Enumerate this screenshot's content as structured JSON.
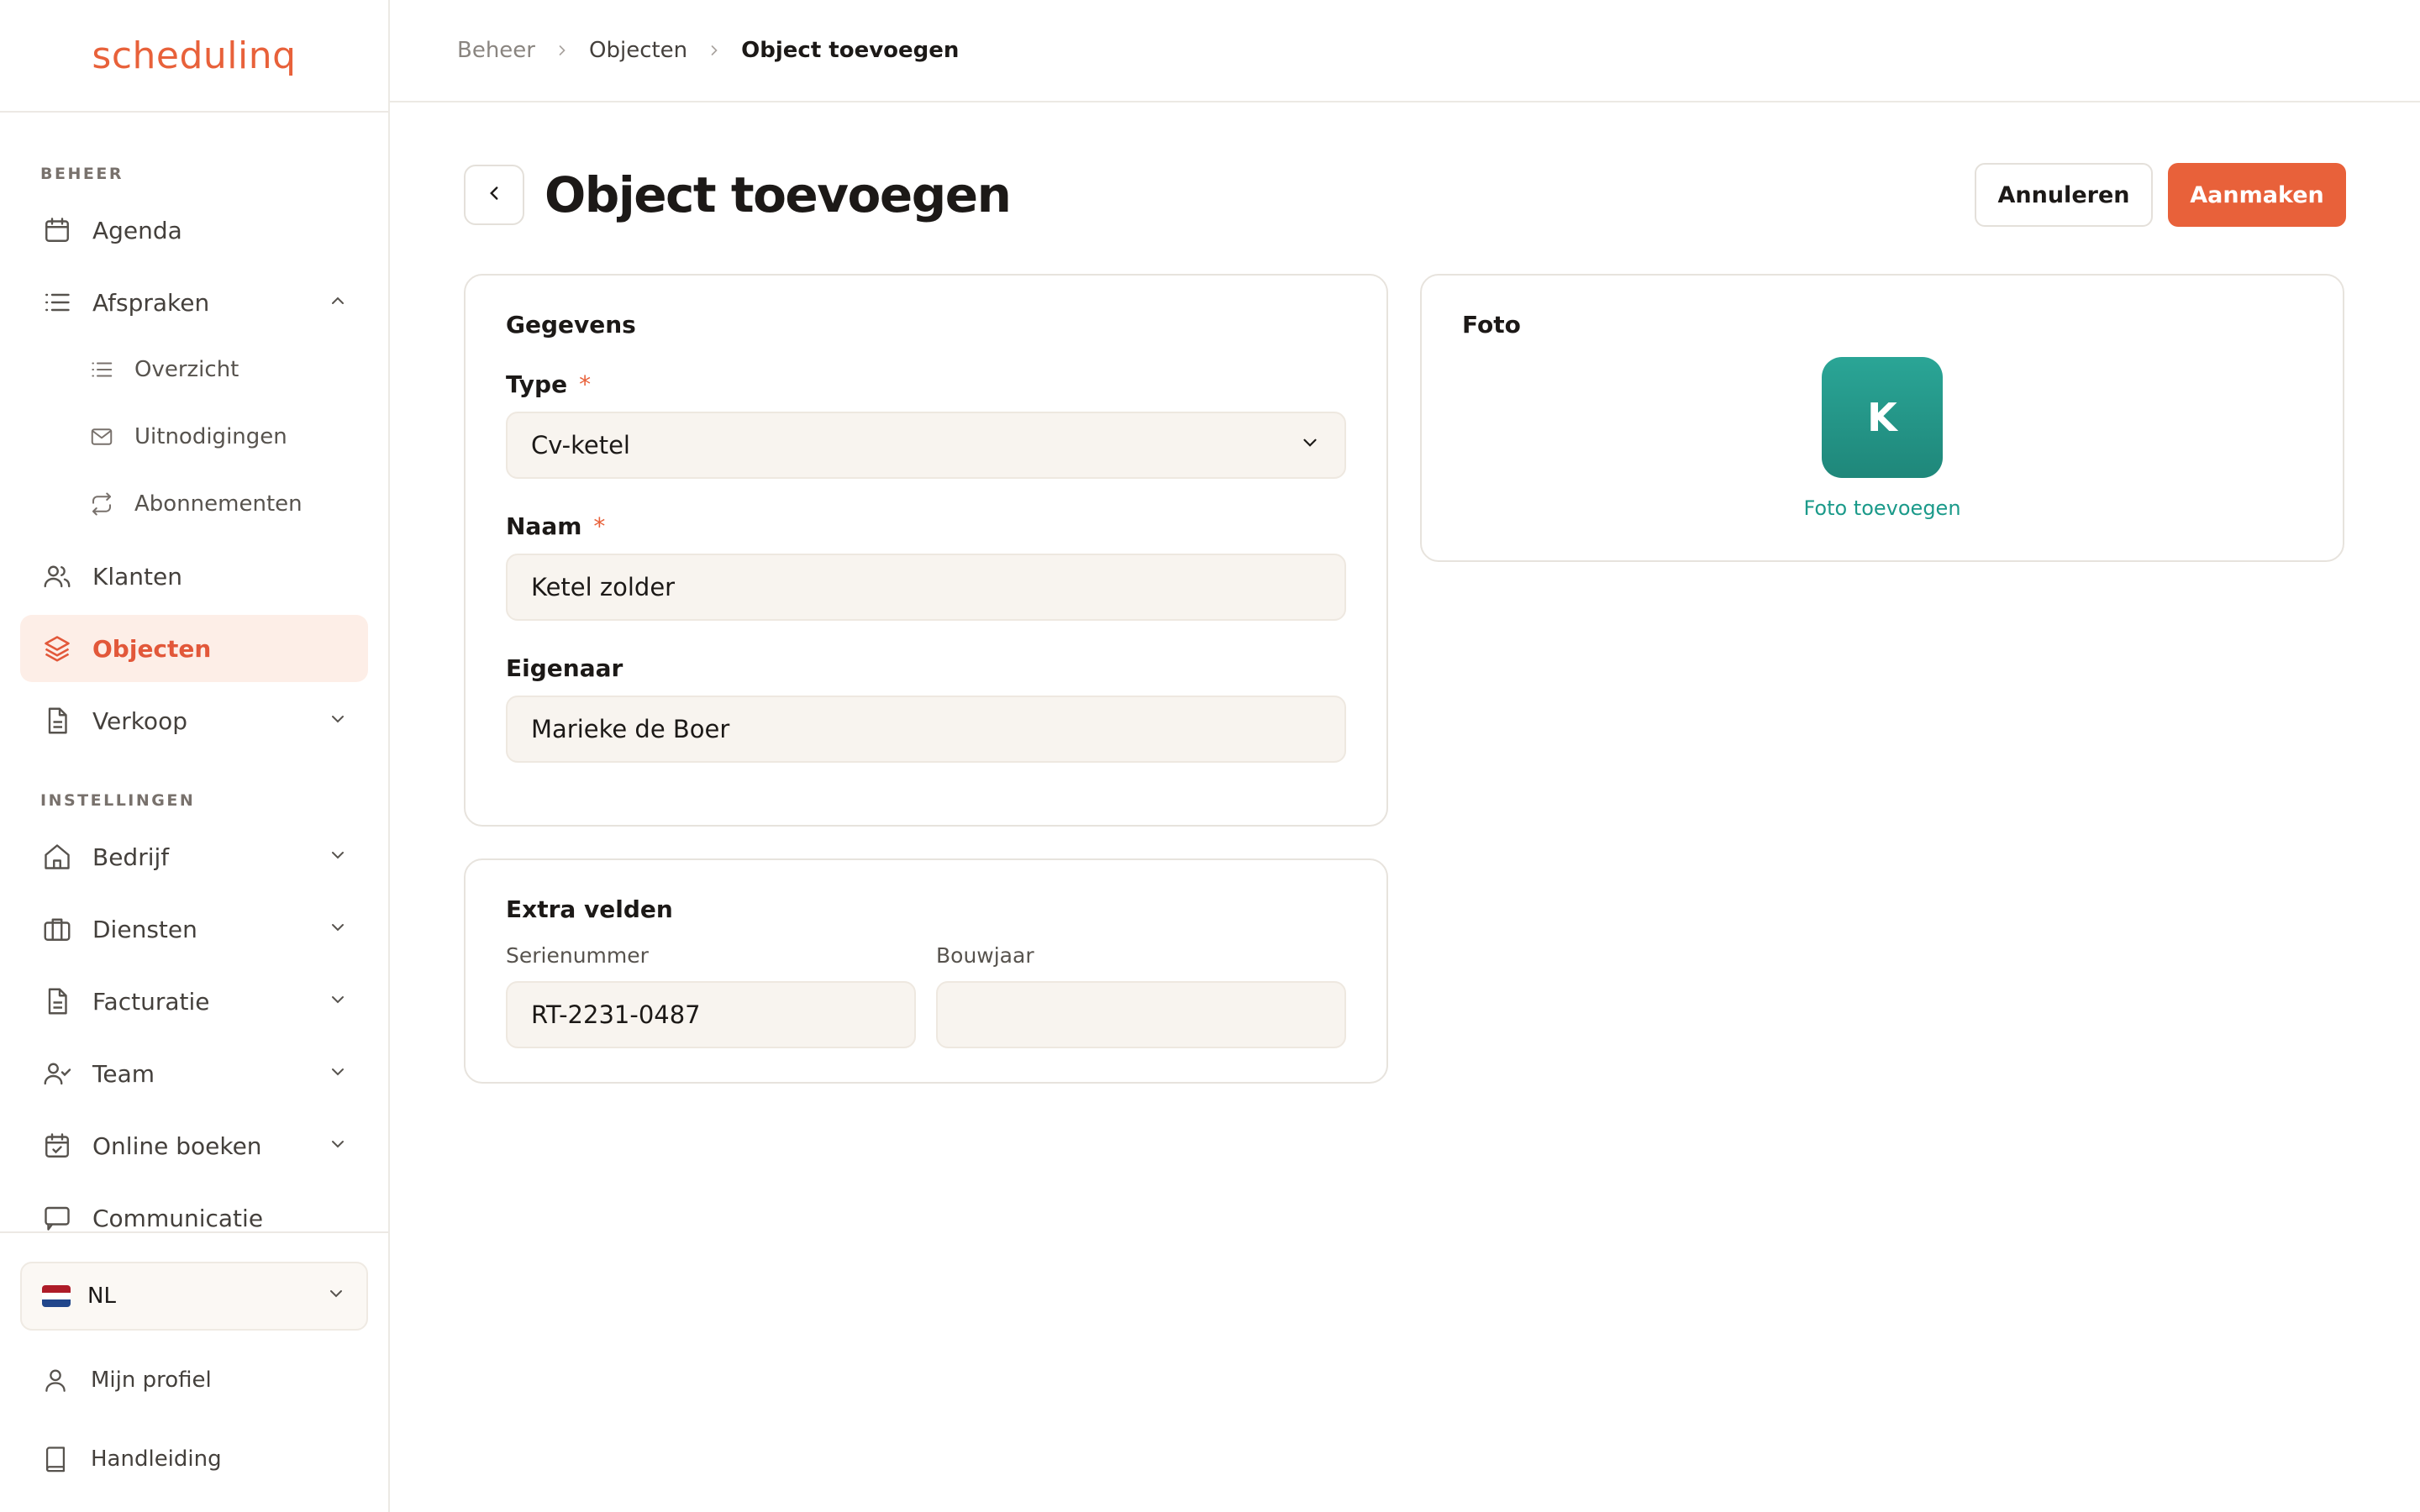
{
  "app": {
    "logo": "schedulinq"
  },
  "sidebar": {
    "section_beheer": "BEHEER",
    "section_instellingen": "INSTELLINGEN",
    "items": {
      "agenda": "Agenda",
      "afspraken": "Afspraken",
      "overzicht": "Overzicht",
      "uitnodigingen": "Uitnodigingen",
      "abonnementen": "Abonnementen",
      "klanten": "Klanten",
      "objecten": "Objecten",
      "verkoop": "Verkoop",
      "bedrijf": "Bedrijf",
      "diensten": "Diensten",
      "facturatie": "Facturatie",
      "team": "Team",
      "online_boeken": "Online boeken",
      "communicatie": "Communicatie"
    },
    "active_item": "objecten",
    "language": "NL",
    "flag_colors": [
      "#ae1c28",
      "#ffffff",
      "#21468b"
    ],
    "profile": "Mijn profiel",
    "manual": "Handleiding"
  },
  "breadcrumb": [
    "Beheer",
    "Objecten",
    "Object toevoegen"
  ],
  "page": {
    "title": "Object toevoegen",
    "cancel_label": "Annuleren",
    "create_label": "Aanmaken"
  },
  "gegevens": {
    "title": "Gegevens",
    "type_label": "Type",
    "type_value": "Cv-ketel",
    "naam_label": "Naam",
    "naam_value": "Ketel zolder",
    "eigenaar_label": "Eigenaar",
    "eigenaar_value": "Marieke de Boer",
    "required_mark": "*"
  },
  "extra": {
    "title": "Extra velden",
    "serienummer_label": "Serienummer",
    "serienummer_value": "RT-2231-0487",
    "bouwjaar_label": "Bouwjaar",
    "bouwjaar_value": ""
  },
  "foto": {
    "title": "Foto",
    "avatar_letter": "K",
    "add_label": "Foto toevoegen"
  },
  "colors": {
    "accent": "#e8613a",
    "active_bg": "#fdeee7",
    "teal": "#1f877a"
  }
}
